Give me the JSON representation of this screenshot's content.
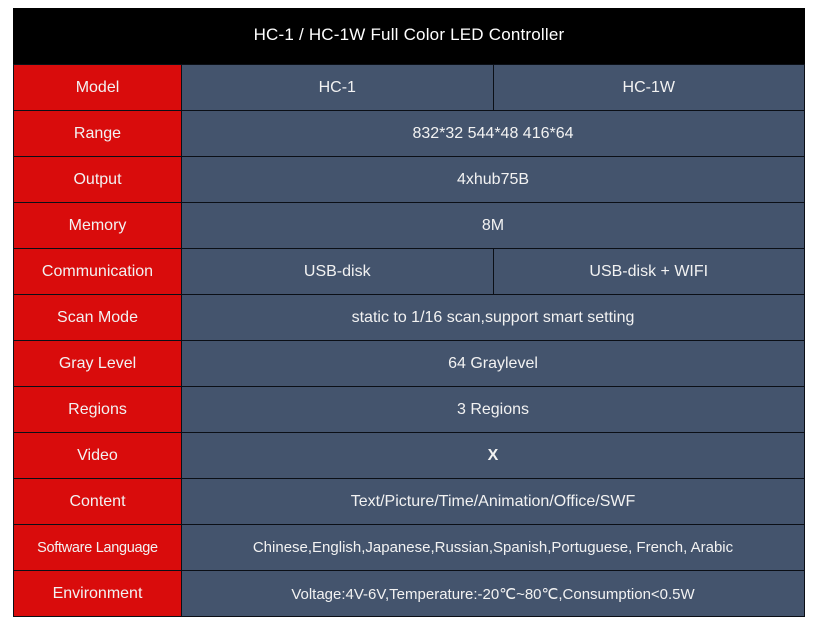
{
  "title": "HC-1 / HC-1W Full Color LED Controller",
  "colors": {
    "label_bg": "#d90c0c",
    "value_bg": "#44546d",
    "title_bg": "#000000",
    "text": "#ffffff",
    "border": "#0b0f16"
  },
  "columns": {
    "spec_header": "Model",
    "model_1": "HC-1",
    "model_2": "HC-1W"
  },
  "rows": [
    {
      "label": "Model",
      "split": true,
      "value_1": "HC-1",
      "value_2": "HC-1W"
    },
    {
      "label": "Range",
      "split": false,
      "value": "832*32  544*48  416*64"
    },
    {
      "label": "Output",
      "split": false,
      "value": "4xhub75B"
    },
    {
      "label": "Memory",
      "split": false,
      "value": "8M"
    },
    {
      "label": "Communication",
      "split": true,
      "value_1": "USB-disk",
      "value_2": "USB-disk + WIFI"
    },
    {
      "label": "Scan Mode",
      "split": false,
      "value": "static to 1/16 scan,support smart setting"
    },
    {
      "label": "Gray Level",
      "split": false,
      "value": "64 Graylevel"
    },
    {
      "label": "Regions",
      "split": false,
      "value": "3 Regions"
    },
    {
      "label": "Video",
      "split": false,
      "value": "X"
    },
    {
      "label": "Content",
      "split": false,
      "value": "Text/Picture/Time/Animation/Office/SWF"
    },
    {
      "label": "Software Language",
      "split": false,
      "value": "Chinese,English,Japanese,Russian,Spanish,Portuguese, French, Arabic"
    },
    {
      "label": "Environment",
      "split": false,
      "value": "Voltage:4V-6V,Temperature:-20℃~80℃,Consumption<0.5W"
    }
  ]
}
